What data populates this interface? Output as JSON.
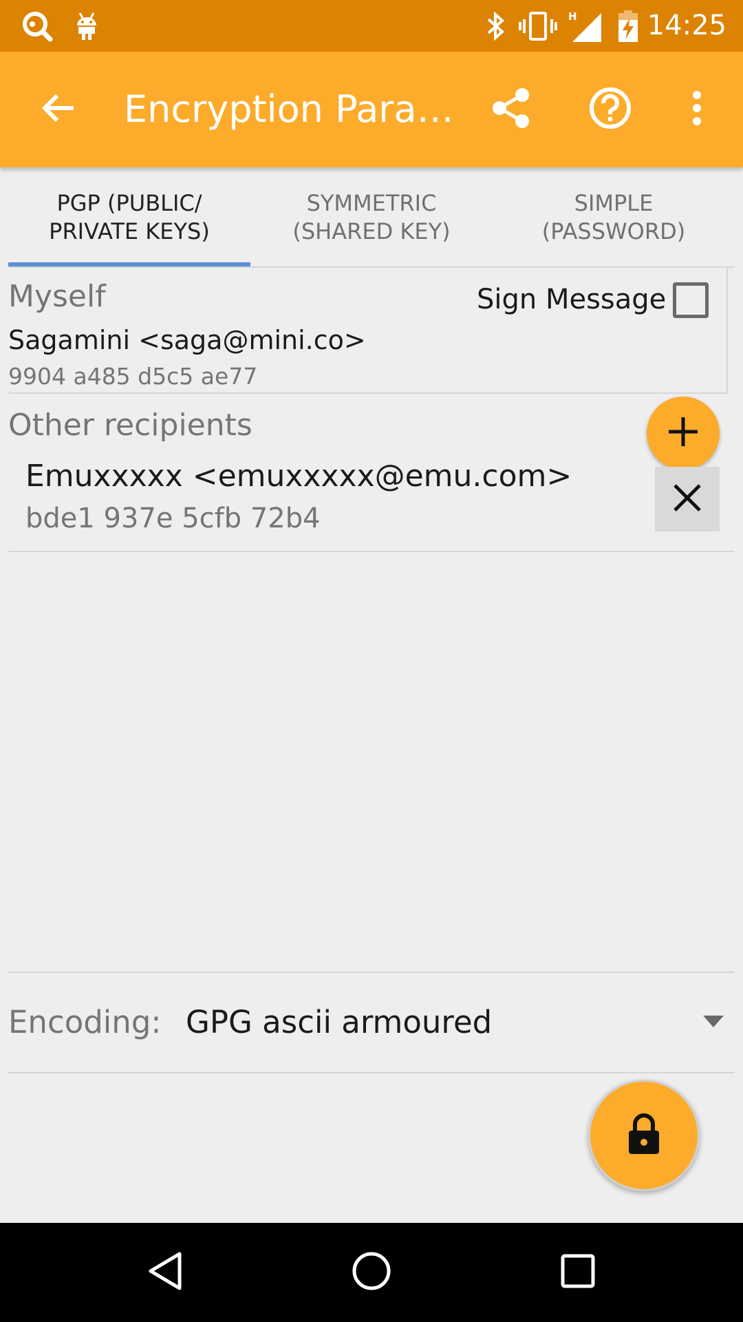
{
  "status_bar": {
    "time": "14:25",
    "network_type": "H",
    "icons": [
      "key-search-icon",
      "android-icon",
      "bluetooth-icon",
      "vibrate-icon",
      "signal-icon",
      "battery-charging-icon"
    ]
  },
  "app_bar": {
    "title": "Encryption Para…",
    "icons": [
      "back-arrow-icon",
      "share-icon",
      "help-icon",
      "overflow-menu-icon"
    ]
  },
  "tabs": [
    {
      "line1": "PGP (PUBLIC/",
      "line2": "PRIVATE KEYS)",
      "active": true
    },
    {
      "line1": "SYMMETRIC",
      "line2": "(SHARED KEY)",
      "active": false
    },
    {
      "line1": "SIMPLE",
      "line2": "(PASSWORD)",
      "active": false
    }
  ],
  "myself": {
    "label": "Myself",
    "name": "Sagamini <saga@mini.co>",
    "fingerprint": "9904 a485 d5c5 ae77",
    "sign_label": "Sign Message",
    "sign_checked": false
  },
  "recipients": {
    "label": "Other recipients",
    "items": [
      {
        "name": "Emuxxxxx <emuxxxxx@emu.com>",
        "fingerprint": "bde1 937e 5cfb 72b4"
      }
    ]
  },
  "encoding": {
    "label": "Encoding:",
    "value": "GPG ascii armoured"
  },
  "colors": {
    "status_bar": "#dd8304",
    "app_bar": "#fdab2b",
    "accent": "#fdab2b",
    "tab_indicator": "#5b8fd6",
    "background": "#eeeeee"
  }
}
